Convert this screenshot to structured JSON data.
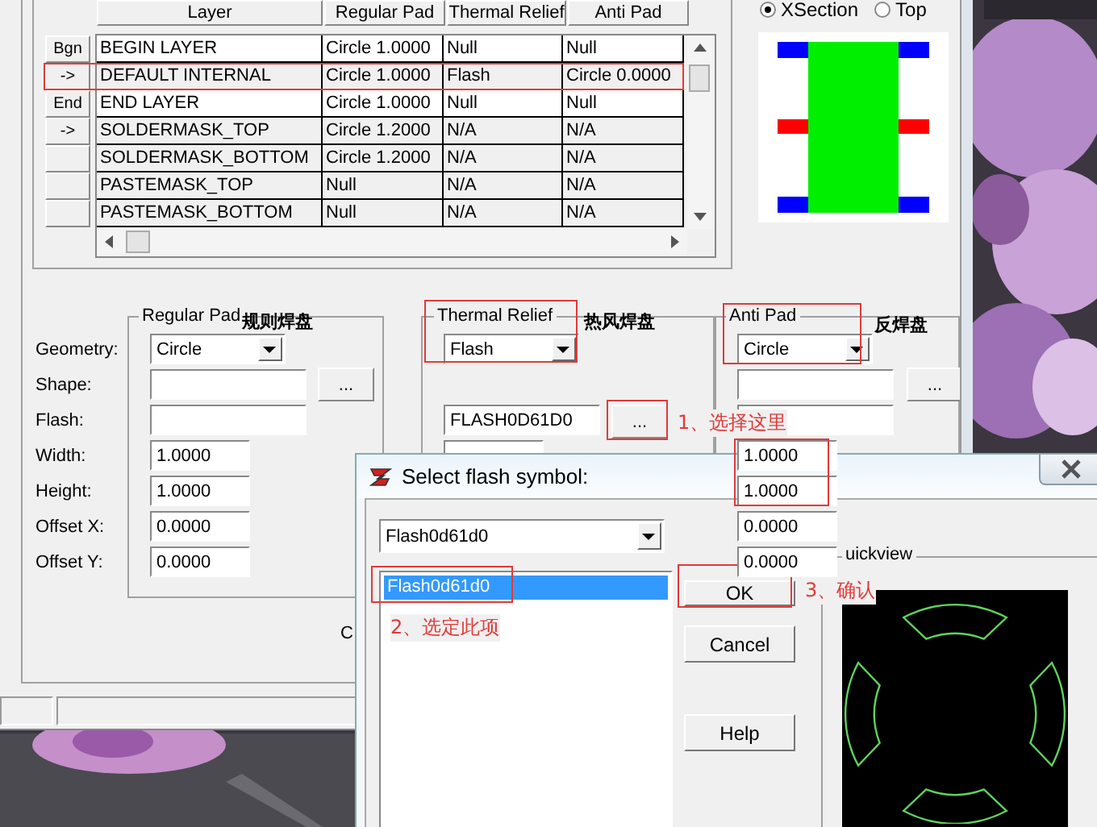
{
  "layer_table": {
    "columns": [
      "Layer",
      "Regular Pad",
      "Thermal Relief",
      "Anti Pad"
    ],
    "rows": [
      {
        "button": "Bgn",
        "cells": [
          "BEGIN LAYER",
          "Circle 1.0000",
          "Null",
          "Null"
        ]
      },
      {
        "button": "->",
        "cells": [
          "DEFAULT INTERNAL",
          "Circle 1.0000",
          "Flash",
          "Circle 0.0000"
        ]
      },
      {
        "button": "End",
        "cells": [
          "END LAYER",
          "Circle 1.0000",
          "Null",
          "Null"
        ]
      },
      {
        "button": "->",
        "cells": [
          "SOLDERMASK_TOP",
          "Circle 1.2000",
          "N/A",
          "N/A"
        ]
      },
      {
        "cells": [
          "SOLDERMASK_BOTTOM",
          "Circle 1.2000",
          "N/A",
          "N/A"
        ]
      },
      {
        "cells": [
          "PASTEMASK_TOP",
          "Null",
          "N/A",
          "N/A"
        ]
      },
      {
        "cells": [
          "PASTEMASK_BOTTOM",
          "Null",
          "N/A",
          "N/A"
        ]
      }
    ]
  },
  "view_mode": [
    {
      "label": "XSection",
      "selected": true
    },
    {
      "label": "Top",
      "selected": false
    }
  ],
  "regular_pad": {
    "title": "Regular Pad",
    "note": "规则焊盘",
    "geometry": "Circle",
    "labels": [
      "Geometry:",
      "Shape:",
      "Flash:",
      "Width:",
      "Height:",
      "Offset X:",
      "Offset Y:"
    ],
    "values": [
      "1.0000",
      "1.0000",
      "0.0000",
      "0.0000"
    ],
    "browse": "..."
  },
  "thermal_relief": {
    "title": "Thermal Relief",
    "note": "热风焊盘",
    "geometry": "Flash",
    "flash": "FLASH0D61D0",
    "browse": "..."
  },
  "anti_pad": {
    "title": "Anti Pad",
    "note": "反焊盘",
    "geometry": "Circle",
    "browse": "...",
    "values": [
      "1.0000",
      "1.0000",
      "0.0000",
      "0.0000"
    ]
  },
  "partial_label": "C",
  "dialog": {
    "title": "Select flash symbol:",
    "combo": "Flash0d61d0",
    "items": [
      {
        "label": "Flash0d61d0",
        "selected": true
      }
    ],
    "buttons": [
      "OK",
      "Cancel",
      "Help"
    ],
    "preview_title": "uickview"
  },
  "annotations": [
    "1、选择这里",
    "2、选定此项",
    "3、确认"
  ]
}
